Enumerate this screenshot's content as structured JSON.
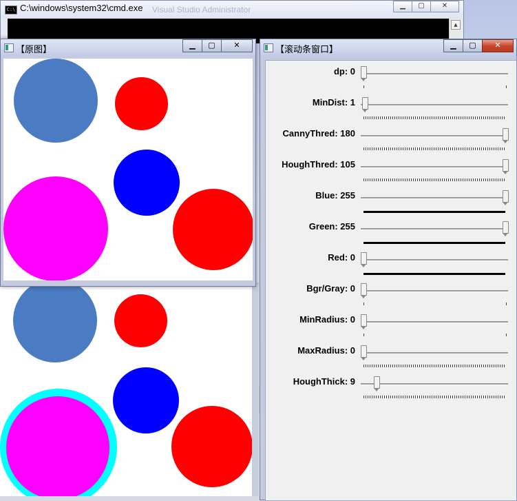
{
  "cmd_window": {
    "title": "C:\\windows\\system32\\cmd.exe",
    "subtitle": "Visual Studio Administrator",
    "icon": "cmd-icon"
  },
  "image_window": {
    "title": "【原图】",
    "icon": "opencv-window-icon"
  },
  "trackbar_window": {
    "title": "【滚动条窗口】",
    "icon": "opencv-window-icon",
    "trackbars": [
      {
        "label": "dp: 0",
        "value": 0,
        "max": 100,
        "ticks": "sparse"
      },
      {
        "label": "MinDist: 1",
        "value": 1,
        "max": 100,
        "ticks": "dense"
      },
      {
        "label": "CannyThred: 180",
        "value": 180,
        "max": 180,
        "ticks": "dense"
      },
      {
        "label": "HoughThred: 105",
        "value": 105,
        "max": 105,
        "ticks": "dense"
      },
      {
        "label": "Blue: 255",
        "value": 255,
        "max": 255,
        "ticks": "solid"
      },
      {
        "label": "Green: 255",
        "value": 255,
        "max": 255,
        "ticks": "solid"
      },
      {
        "label": "Red: 0",
        "value": 0,
        "max": 255,
        "ticks": "solid"
      },
      {
        "label": "Bgr/Gray: 0",
        "value": 0,
        "max": 1,
        "ticks": "sparse"
      },
      {
        "label": "MinRadius: 0",
        "value": 0,
        "max": 100,
        "ticks": "sparse"
      },
      {
        "label": "MaxRadius: 0",
        "value": 0,
        "max": 100,
        "ticks": "dense"
      },
      {
        "label": "HoughThick: 9",
        "value": 9,
        "max": 100,
        "ticks": "dense"
      }
    ]
  },
  "colors": {
    "steel_blue": "#4a7bc3",
    "red": "#ff0000",
    "blue": "#0000ff",
    "magenta": "#ff00ff",
    "cyan": "#00ffff"
  }
}
